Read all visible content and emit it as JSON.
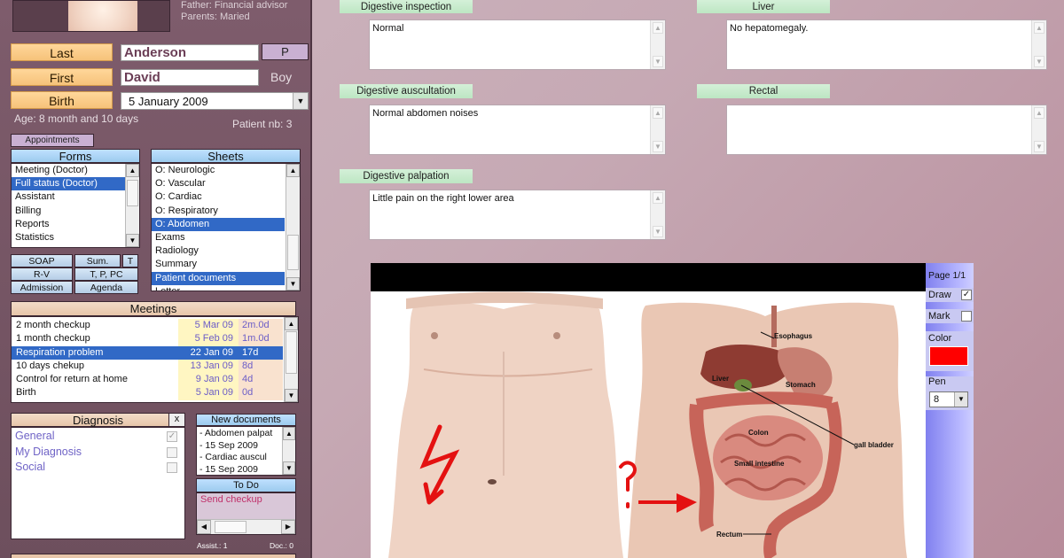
{
  "patient": {
    "father": "Father: Financial advisor",
    "parents": "Parents: Maried",
    "last_label": "Last",
    "last_name": "Anderson",
    "p_button": "P",
    "first_label": "First",
    "first_name": "David",
    "gender": "Boy",
    "birth_label": "Birth",
    "birth_date": "5   January   2009",
    "age": "Age: 8 month and 10 days",
    "patient_nb": "Patient nb: 3"
  },
  "appointments_button": "Appointments",
  "forms": {
    "title": "Forms",
    "items": [
      "Meeting (Doctor)",
      "Full status (Doctor)",
      "Assistant",
      "Billing",
      "Reports",
      "Statistics"
    ],
    "selected": 1
  },
  "sheets": {
    "title": "Sheets",
    "items": [
      "O: Neurologic",
      "O: Vascular",
      "O: Cardiac",
      "O: Respiratory",
      "O: Abdomen",
      "Exams",
      "Radiology",
      "Summary",
      "Patient documents",
      "Letter"
    ],
    "selected": [
      4,
      8
    ]
  },
  "quick_buttons": {
    "soap": "SOAP",
    "sum": "Sum.",
    "t": "T",
    "rv": "R-V",
    "tppc": "T, P, PC",
    "admission": "Admission",
    "agenda": "Agenda"
  },
  "meetings": {
    "title": "Meetings",
    "rows": [
      {
        "name": "2 month checkup",
        "date": "5 Mar 09",
        "age": "2m.0d"
      },
      {
        "name": "1 month checkup",
        "date": "5 Feb 09",
        "age": "1m.0d"
      },
      {
        "name": "Respiration problem",
        "date": "22 Jan 09",
        "age": "17d"
      },
      {
        "name": "10 days chekup",
        "date": "13 Jan 09",
        "age": "8d"
      },
      {
        "name": "Control for return at home",
        "date": "9 Jan 09",
        "age": "4d"
      },
      {
        "name": "Birth",
        "date": "5 Jan 09",
        "age": "0d"
      }
    ],
    "selected": 2
  },
  "diagnosis": {
    "title": "Diagnosis",
    "close": "x",
    "items": [
      {
        "label": "General",
        "checked": true
      },
      {
        "label": "My Diagnosis",
        "checked": false
      },
      {
        "label": "Social",
        "checked": false
      }
    ]
  },
  "new_documents": {
    "title": "New documents",
    "items": [
      "- Abdomen palpat",
      "- 15 Sep 2009",
      "- Cardiac auscul",
      "- 15 Sep 2009"
    ]
  },
  "todo": {
    "title": "To Do",
    "items": [
      "Send checkup"
    ]
  },
  "footer": {
    "assist": "Assist.: 1",
    "doc": "Doc.: 0"
  },
  "sections": {
    "digestive_inspection": {
      "label": "Digestive inspection",
      "value": "Normal"
    },
    "liver": {
      "label": "Liver",
      "value": "No hepatomegaly."
    },
    "digestive_auscultation": {
      "label": "Digestive auscultation",
      "value": "Normal abdomen noises"
    },
    "rectal": {
      "label": "Rectal",
      "value": ""
    },
    "digestive_palpation": {
      "label": "Digestive palpation",
      "value": "Little pain on the right lower area"
    }
  },
  "diagram": {
    "labels": [
      "Esophagus",
      "Liver",
      "Stomach",
      "Colon",
      "gall bladder",
      "Small intestine",
      "Rectum"
    ],
    "annotation": "?"
  },
  "tools": {
    "page": "Page 1/1",
    "draw_label": "Draw",
    "draw_checked": true,
    "mark_label": "Mark",
    "mark_checked": false,
    "color_label": "Color",
    "color_value": "#ff0000",
    "pen_label": "Pen",
    "pen_value": "8"
  }
}
